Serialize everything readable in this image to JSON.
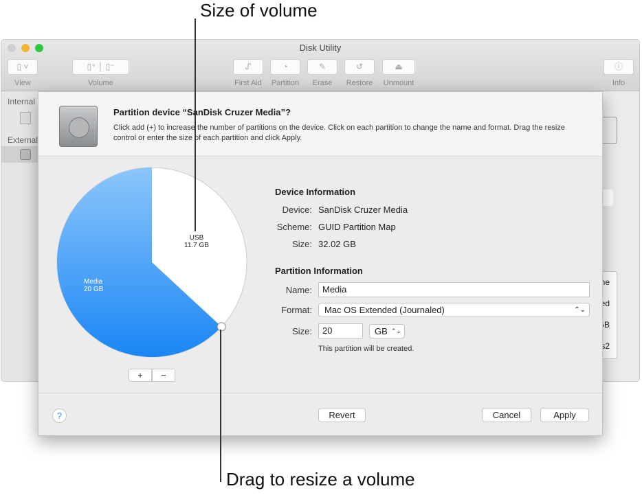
{
  "annotations": {
    "top": "Size of volume",
    "bottom": "Drag to resize a volume"
  },
  "window": {
    "title": "Disk Utility",
    "toolbar": [
      {
        "label": "View",
        "icon": "sidebar-icon"
      },
      {
        "label": "Volume",
        "icon": "volume-add-remove-icon"
      },
      {
        "label": "First Aid",
        "icon": "stethoscope-icon"
      },
      {
        "label": "Partition",
        "icon": "pie-icon"
      },
      {
        "label": "Erase",
        "icon": "erase-icon"
      },
      {
        "label": "Restore",
        "icon": "restore-icon"
      },
      {
        "label": "Unmount",
        "icon": "eject-icon"
      },
      {
        "label": "Info",
        "icon": "info-icon"
      }
    ],
    "sidebar": {
      "internal": "Internal",
      "external": "External"
    },
    "behind_text": [
      "ne",
      "ed",
      "GB",
      "s2"
    ]
  },
  "sheet": {
    "title": "Partition device “SanDisk Cruzer Media”?",
    "description": "Click add (+) to increase the number of partitions on the device. Click on each partition to change the name and format. Drag the resize control or enter the size of each partition and click Apply.",
    "pie": {
      "partitions": [
        {
          "name": "USB",
          "size": "11.7 GB",
          "value": 11.7,
          "color": "#ffffff"
        },
        {
          "name": "Media",
          "size": "20 GB",
          "value": 20,
          "color": "#3d9cf5"
        }
      ]
    },
    "add": "+",
    "remove": "−",
    "device_info": {
      "heading": "Device Information",
      "device_label": "Device:",
      "device": "SanDisk Cruzer Media",
      "scheme_label": "Scheme:",
      "scheme": "GUID Partition Map",
      "size_label": "Size:",
      "size": "32.02 GB"
    },
    "partition_info": {
      "heading": "Partition Information",
      "name_label": "Name:",
      "name": "Media",
      "format_label": "Format:",
      "format": "Mac OS Extended (Journaled)",
      "size_label": "Size:",
      "size": "20",
      "unit": "GB",
      "note": "This partition will be created."
    },
    "help": "?",
    "revert": "Revert",
    "cancel": "Cancel",
    "apply": "Apply"
  }
}
